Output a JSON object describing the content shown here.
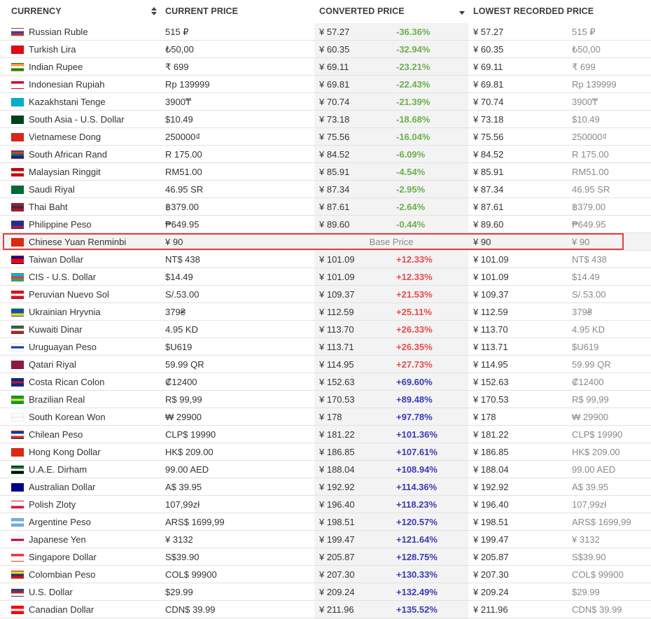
{
  "table": {
    "headers": {
      "currency": "CURRENCY",
      "current_price": "CURRENT PRICE",
      "converted_price": "CONVERTED PRICE",
      "lowest_recorded_price": "LOWEST RECORDED PRICE"
    },
    "rows": [
      {
        "currency": "Russian Ruble",
        "price": "515 ₽",
        "converted": "¥ 57.27",
        "pct": "-36.36%",
        "low_conv": "¥ 57.27",
        "low_price": "515 ₽",
        "flag": [
          "#ffffff",
          "#1f47b8",
          "#d52b1e"
        ],
        "pct_color": "green"
      },
      {
        "currency": "Turkish Lira",
        "price": "₺50,00",
        "converted": "¥ 60.35",
        "pct": "-32.94%",
        "low_conv": "¥ 60.35",
        "low_price": "₺50,00",
        "flag": [
          "#e30a17",
          "#e30a17",
          "#e30a17"
        ],
        "pct_color": "green"
      },
      {
        "currency": "Indian Rupee",
        "price": "₹ 699",
        "converted": "¥ 69.11",
        "pct": "-23.21%",
        "low_conv": "¥ 69.11",
        "low_price": "₹ 699",
        "flag": [
          "#ff9933",
          "#ffffff",
          "#138808"
        ],
        "pct_color": "green"
      },
      {
        "currency": "Indonesian Rupiah",
        "price": "Rp 139999",
        "converted": "¥ 69.81",
        "pct": "-22.43%",
        "low_conv": "¥ 69.81",
        "low_price": "Rp 139999",
        "flag": [
          "#ce1126",
          "#ffffff",
          "#ffffff"
        ],
        "pct_color": "green"
      },
      {
        "currency": "Kazakhstani Tenge",
        "price": "3900₸",
        "converted": "¥ 70.74",
        "pct": "-21.39%",
        "low_conv": "¥ 70.74",
        "low_price": "3900₸",
        "flag": [
          "#00afca",
          "#00afca",
          "#00afca"
        ],
        "pct_color": "green"
      },
      {
        "currency": "South Asia - U.S. Dollar",
        "price": "$10.49",
        "converted": "¥ 73.18",
        "pct": "-18.68%",
        "low_conv": "¥ 73.18",
        "low_price": "$10.49",
        "flag": [
          "#01411c",
          "#01411c",
          "#01411c"
        ],
        "pct_color": "green"
      },
      {
        "currency": "Vietnamese Dong",
        "price": "250000₫",
        "converted": "¥ 75.56",
        "pct": "-16.04%",
        "low_conv": "¥ 75.56",
        "low_price": "250000₫",
        "flag": [
          "#da251d",
          "#da251d",
          "#da251d"
        ],
        "pct_color": "green"
      },
      {
        "currency": "South African Rand",
        "price": "R 175.00",
        "converted": "¥ 84.52",
        "pct": "-6.09%",
        "low_conv": "¥ 84.52",
        "low_price": "R 175.00",
        "flag": [
          "#de3831",
          "#007a4d",
          "#002395"
        ],
        "pct_color": "green"
      },
      {
        "currency": "Malaysian Ringgit",
        "price": "RM51.00",
        "converted": "¥ 85.91",
        "pct": "-4.54%",
        "low_conv": "¥ 85.91",
        "low_price": "RM51.00",
        "flag": [
          "#cc0001",
          "#ffffff",
          "#cc0001"
        ],
        "pct_color": "green"
      },
      {
        "currency": "Saudi Riyal",
        "price": "46.95 SR",
        "converted": "¥ 87.34",
        "pct": "-2.95%",
        "low_conv": "¥ 87.34",
        "low_price": "46.95 SR",
        "flag": [
          "#006c35",
          "#006c35",
          "#006c35"
        ],
        "pct_color": "green"
      },
      {
        "currency": "Thai Baht",
        "price": "฿379.00",
        "converted": "¥ 87.61",
        "pct": "-2.64%",
        "low_conv": "¥ 87.61",
        "low_price": "฿379.00",
        "flag": [
          "#a51931",
          "#2d2a4a",
          "#a51931"
        ],
        "pct_color": "green"
      },
      {
        "currency": "Philippine Peso",
        "price": "₱649.95",
        "converted": "¥ 89.60",
        "pct": "-0.44%",
        "low_conv": "¥ 89.60",
        "low_price": "₱649.95",
        "flag": [
          "#0038a8",
          "#0038a8",
          "#ce1126"
        ],
        "pct_color": "green"
      },
      {
        "currency": "Chinese Yuan Renminbi",
        "price": "¥ 90",
        "base_label": "Base Price",
        "low_conv": "¥ 90",
        "low_price": "¥ 90",
        "flag": [
          "#de2910",
          "#de2910",
          "#de2910"
        ],
        "is_base": true
      },
      {
        "currency": "Taiwan Dollar",
        "price": "NT$ 438",
        "converted": "¥ 101.09",
        "pct": "+12.33%",
        "low_conv": "¥ 101.09",
        "low_price": "NT$ 438",
        "flag": [
          "#000095",
          "#fe0000",
          "#fe0000"
        ],
        "pct_color": "red"
      },
      {
        "currency": "CIS - U.S. Dollar",
        "price": "$14.49",
        "converted": "¥ 101.09",
        "pct": "+12.33%",
        "low_conv": "¥ 101.09",
        "low_price": "$14.49",
        "flag": [
          "#00b5e2",
          "#ef3340",
          "#509e2f"
        ],
        "pct_color": "red"
      },
      {
        "currency": "Peruvian Nuevo Sol",
        "price": "S/.53.00",
        "converted": "¥ 109.37",
        "pct": "+21.53%",
        "low_conv": "¥ 109.37",
        "low_price": "S/.53.00",
        "flag": [
          "#d91023",
          "#ffffff",
          "#d91023"
        ],
        "pct_color": "red"
      },
      {
        "currency": "Ukrainian Hryvnia",
        "price": "379₴",
        "converted": "¥ 112.59",
        "pct": "+25.11%",
        "low_conv": "¥ 112.59",
        "low_price": "379₴",
        "flag": [
          "#0057b7",
          "#0057b7",
          "#ffd700"
        ],
        "pct_color": "red"
      },
      {
        "currency": "Kuwaiti Dinar",
        "price": "4.95 KD",
        "converted": "¥ 113.70",
        "pct": "+26.33%",
        "low_conv": "¥ 113.70",
        "low_price": "4.95 KD",
        "flag": [
          "#007a3d",
          "#ffffff",
          "#ce1126"
        ],
        "pct_color": "red"
      },
      {
        "currency": "Uruguayan Peso",
        "price": "$U619",
        "converted": "¥ 113.71",
        "pct": "+26.35%",
        "low_conv": "¥ 113.71",
        "low_price": "$U619",
        "flag": [
          "#ffffff",
          "#0038a8",
          "#ffffff"
        ],
        "pct_color": "red"
      },
      {
        "currency": "Qatari Riyal",
        "price": "59.99 QR",
        "converted": "¥ 114.95",
        "pct": "+27.73%",
        "low_conv": "¥ 114.95",
        "low_price": "59.99 QR",
        "flag": [
          "#8d1b3d",
          "#8d1b3d",
          "#8d1b3d"
        ],
        "pct_color": "red"
      },
      {
        "currency": "Costa Rican Colon",
        "price": "₡12400",
        "converted": "¥ 152.63",
        "pct": "+69.60%",
        "low_conv": "¥ 152.63",
        "low_price": "₡12400",
        "flag": [
          "#002b7f",
          "#ce1126",
          "#002b7f"
        ],
        "pct_color": "blue"
      },
      {
        "currency": "Brazilian Real",
        "price": "R$ 99,99",
        "converted": "¥ 170.53",
        "pct": "+89.48%",
        "low_conv": "¥ 170.53",
        "low_price": "R$ 99,99",
        "flag": [
          "#009c3b",
          "#ffdf00",
          "#009c3b"
        ],
        "pct_color": "blue"
      },
      {
        "currency": "South Korean Won",
        "price": "₩ 29900",
        "converted": "¥ 178",
        "pct": "+97.78%",
        "low_conv": "¥ 178",
        "low_price": "₩ 29900",
        "flag": [
          "#ffffff",
          "#f2f2f2",
          "#ffffff"
        ],
        "pct_color": "blue"
      },
      {
        "currency": "Chilean Peso",
        "price": "CLP$ 19990",
        "converted": "¥ 181.22",
        "pct": "+101.36%",
        "low_conv": "¥ 181.22",
        "low_price": "CLP$ 19990",
        "flag": [
          "#0039a6",
          "#ffffff",
          "#d52b1e"
        ],
        "pct_color": "blue"
      },
      {
        "currency": "Hong Kong Dollar",
        "price": "HK$ 209.00",
        "converted": "¥ 186.85",
        "pct": "+107.61%",
        "low_conv": "¥ 186.85",
        "low_price": "HK$ 209.00",
        "flag": [
          "#de2910",
          "#de2910",
          "#de2910"
        ],
        "pct_color": "blue"
      },
      {
        "currency": "U.A.E. Dirham",
        "price": "99.00 AED",
        "converted": "¥ 188.04",
        "pct": "+108.94%",
        "low_conv": "¥ 188.04",
        "low_price": "99.00 AED",
        "flag": [
          "#00732f",
          "#ffffff",
          "#000000"
        ],
        "pct_color": "blue"
      },
      {
        "currency": "Australian Dollar",
        "price": "A$ 39.95",
        "converted": "¥ 192.92",
        "pct": "+114.36%",
        "low_conv": "¥ 192.92",
        "low_price": "A$ 39.95",
        "flag": [
          "#00008b",
          "#00008b",
          "#00008b"
        ],
        "pct_color": "blue"
      },
      {
        "currency": "Polish Zloty",
        "price": "107,99zł",
        "converted": "¥ 196.40",
        "pct": "+118.23%",
        "low_conv": "¥ 196.40",
        "low_price": "107,99zł",
        "flag": [
          "#ffffff",
          "#ffffff",
          "#dc143c"
        ],
        "pct_color": "blue"
      },
      {
        "currency": "Argentine Peso",
        "price": "ARS$ 1699,99",
        "converted": "¥ 198.51",
        "pct": "+120.57%",
        "low_conv": "¥ 198.51",
        "low_price": "ARS$ 1699,99",
        "flag": [
          "#74acdf",
          "#ffffff",
          "#74acdf"
        ],
        "pct_color": "blue"
      },
      {
        "currency": "Japanese Yen",
        "price": "¥ 3132",
        "converted": "¥ 199.47",
        "pct": "+121.64%",
        "low_conv": "¥ 199.47",
        "low_price": "¥ 3132",
        "flag": [
          "#ffffff",
          "#bc002d",
          "#ffffff"
        ],
        "pct_color": "blue"
      },
      {
        "currency": "Singapore Dollar",
        "price": "S$39.90",
        "converted": "¥ 205.87",
        "pct": "+128.75%",
        "low_conv": "¥ 205.87",
        "low_price": "S$39.90",
        "flag": [
          "#ef3340",
          "#ffffff",
          "#ffffff"
        ],
        "pct_color": "blue"
      },
      {
        "currency": "Colombian Peso",
        "price": "COL$ 99900",
        "converted": "¥ 207.30",
        "pct": "+130.33%",
        "low_conv": "¥ 207.30",
        "low_price": "COL$ 99900",
        "flag": [
          "#fcd116",
          "#003893",
          "#ce1126"
        ],
        "pct_color": "blue"
      },
      {
        "currency": "U.S. Dollar",
        "price": "$29.99",
        "converted": "¥ 209.24",
        "pct": "+132.49%",
        "low_conv": "¥ 209.24",
        "low_price": "$29.99",
        "flag": [
          "#3c3b6e",
          "#b22234",
          "#ffffff"
        ],
        "pct_color": "blue"
      },
      {
        "currency": "Canadian Dollar",
        "price": "CDN$ 39.99",
        "converted": "¥ 211.96",
        "pct": "+135.52%",
        "low_conv": "¥ 211.96",
        "low_price": "CDN$ 39.99",
        "flag": [
          "#ff0000",
          "#ffffff",
          "#ff0000"
        ],
        "pct_color": "blue"
      }
    ]
  },
  "colors": {
    "pct_green": "#6ab04c",
    "pct_red": "#e74c4c",
    "pct_blue": "#3b3bb5",
    "highlight_border": "#e04040",
    "converted_column_bg": "#f3f3f3"
  },
  "icons": {
    "currency_sort": "sort-up-down-icon",
    "converted_sort": "sort-desc-icon"
  }
}
